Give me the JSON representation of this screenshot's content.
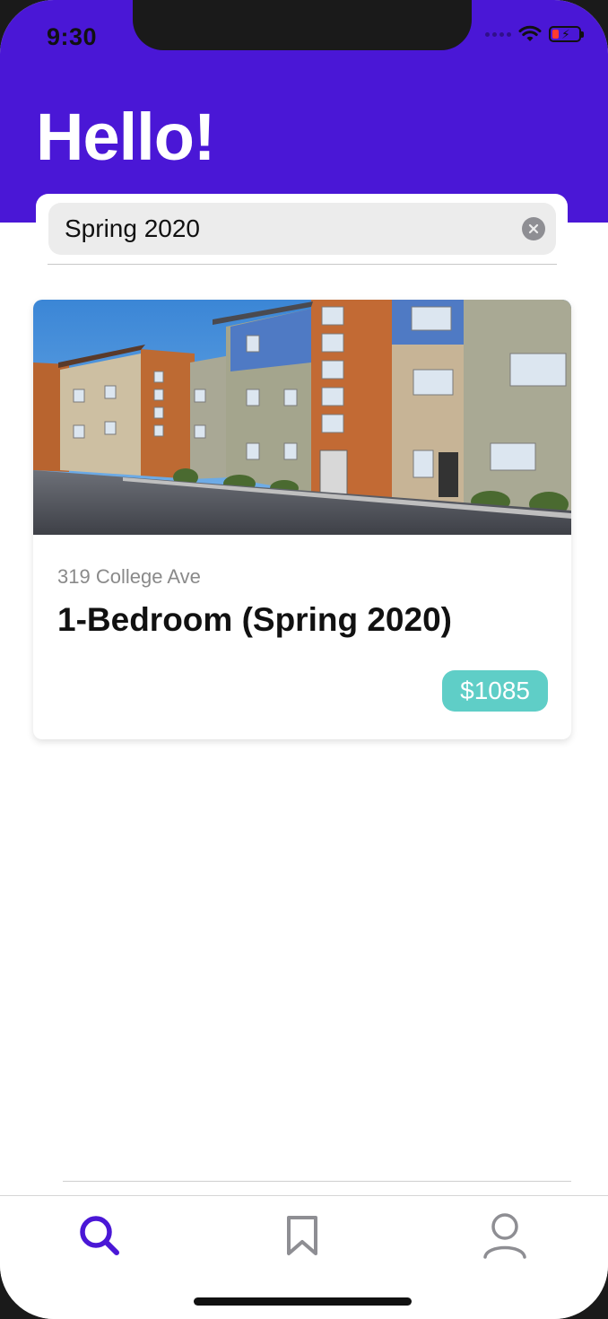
{
  "status_bar": {
    "time": "9:30"
  },
  "header": {
    "title": "Hello!",
    "background_color": "#4a17d6"
  },
  "search": {
    "value": "Spring 2020",
    "clear_icon": "clear-circle-icon"
  },
  "listing": {
    "photo_alt": "apartment-building-photo",
    "address": "319 College Ave",
    "title": "1-Bedroom (Spring 2020)",
    "price": "$1085",
    "price_color": "#5fcec7"
  },
  "tab_bar": {
    "active_color": "#4a17d6",
    "inactive_color": "#8e8e93",
    "tabs": [
      {
        "icon": "search-icon",
        "active": true
      },
      {
        "icon": "bookmark-icon",
        "active": false
      },
      {
        "icon": "profile-icon",
        "active": false
      }
    ]
  }
}
